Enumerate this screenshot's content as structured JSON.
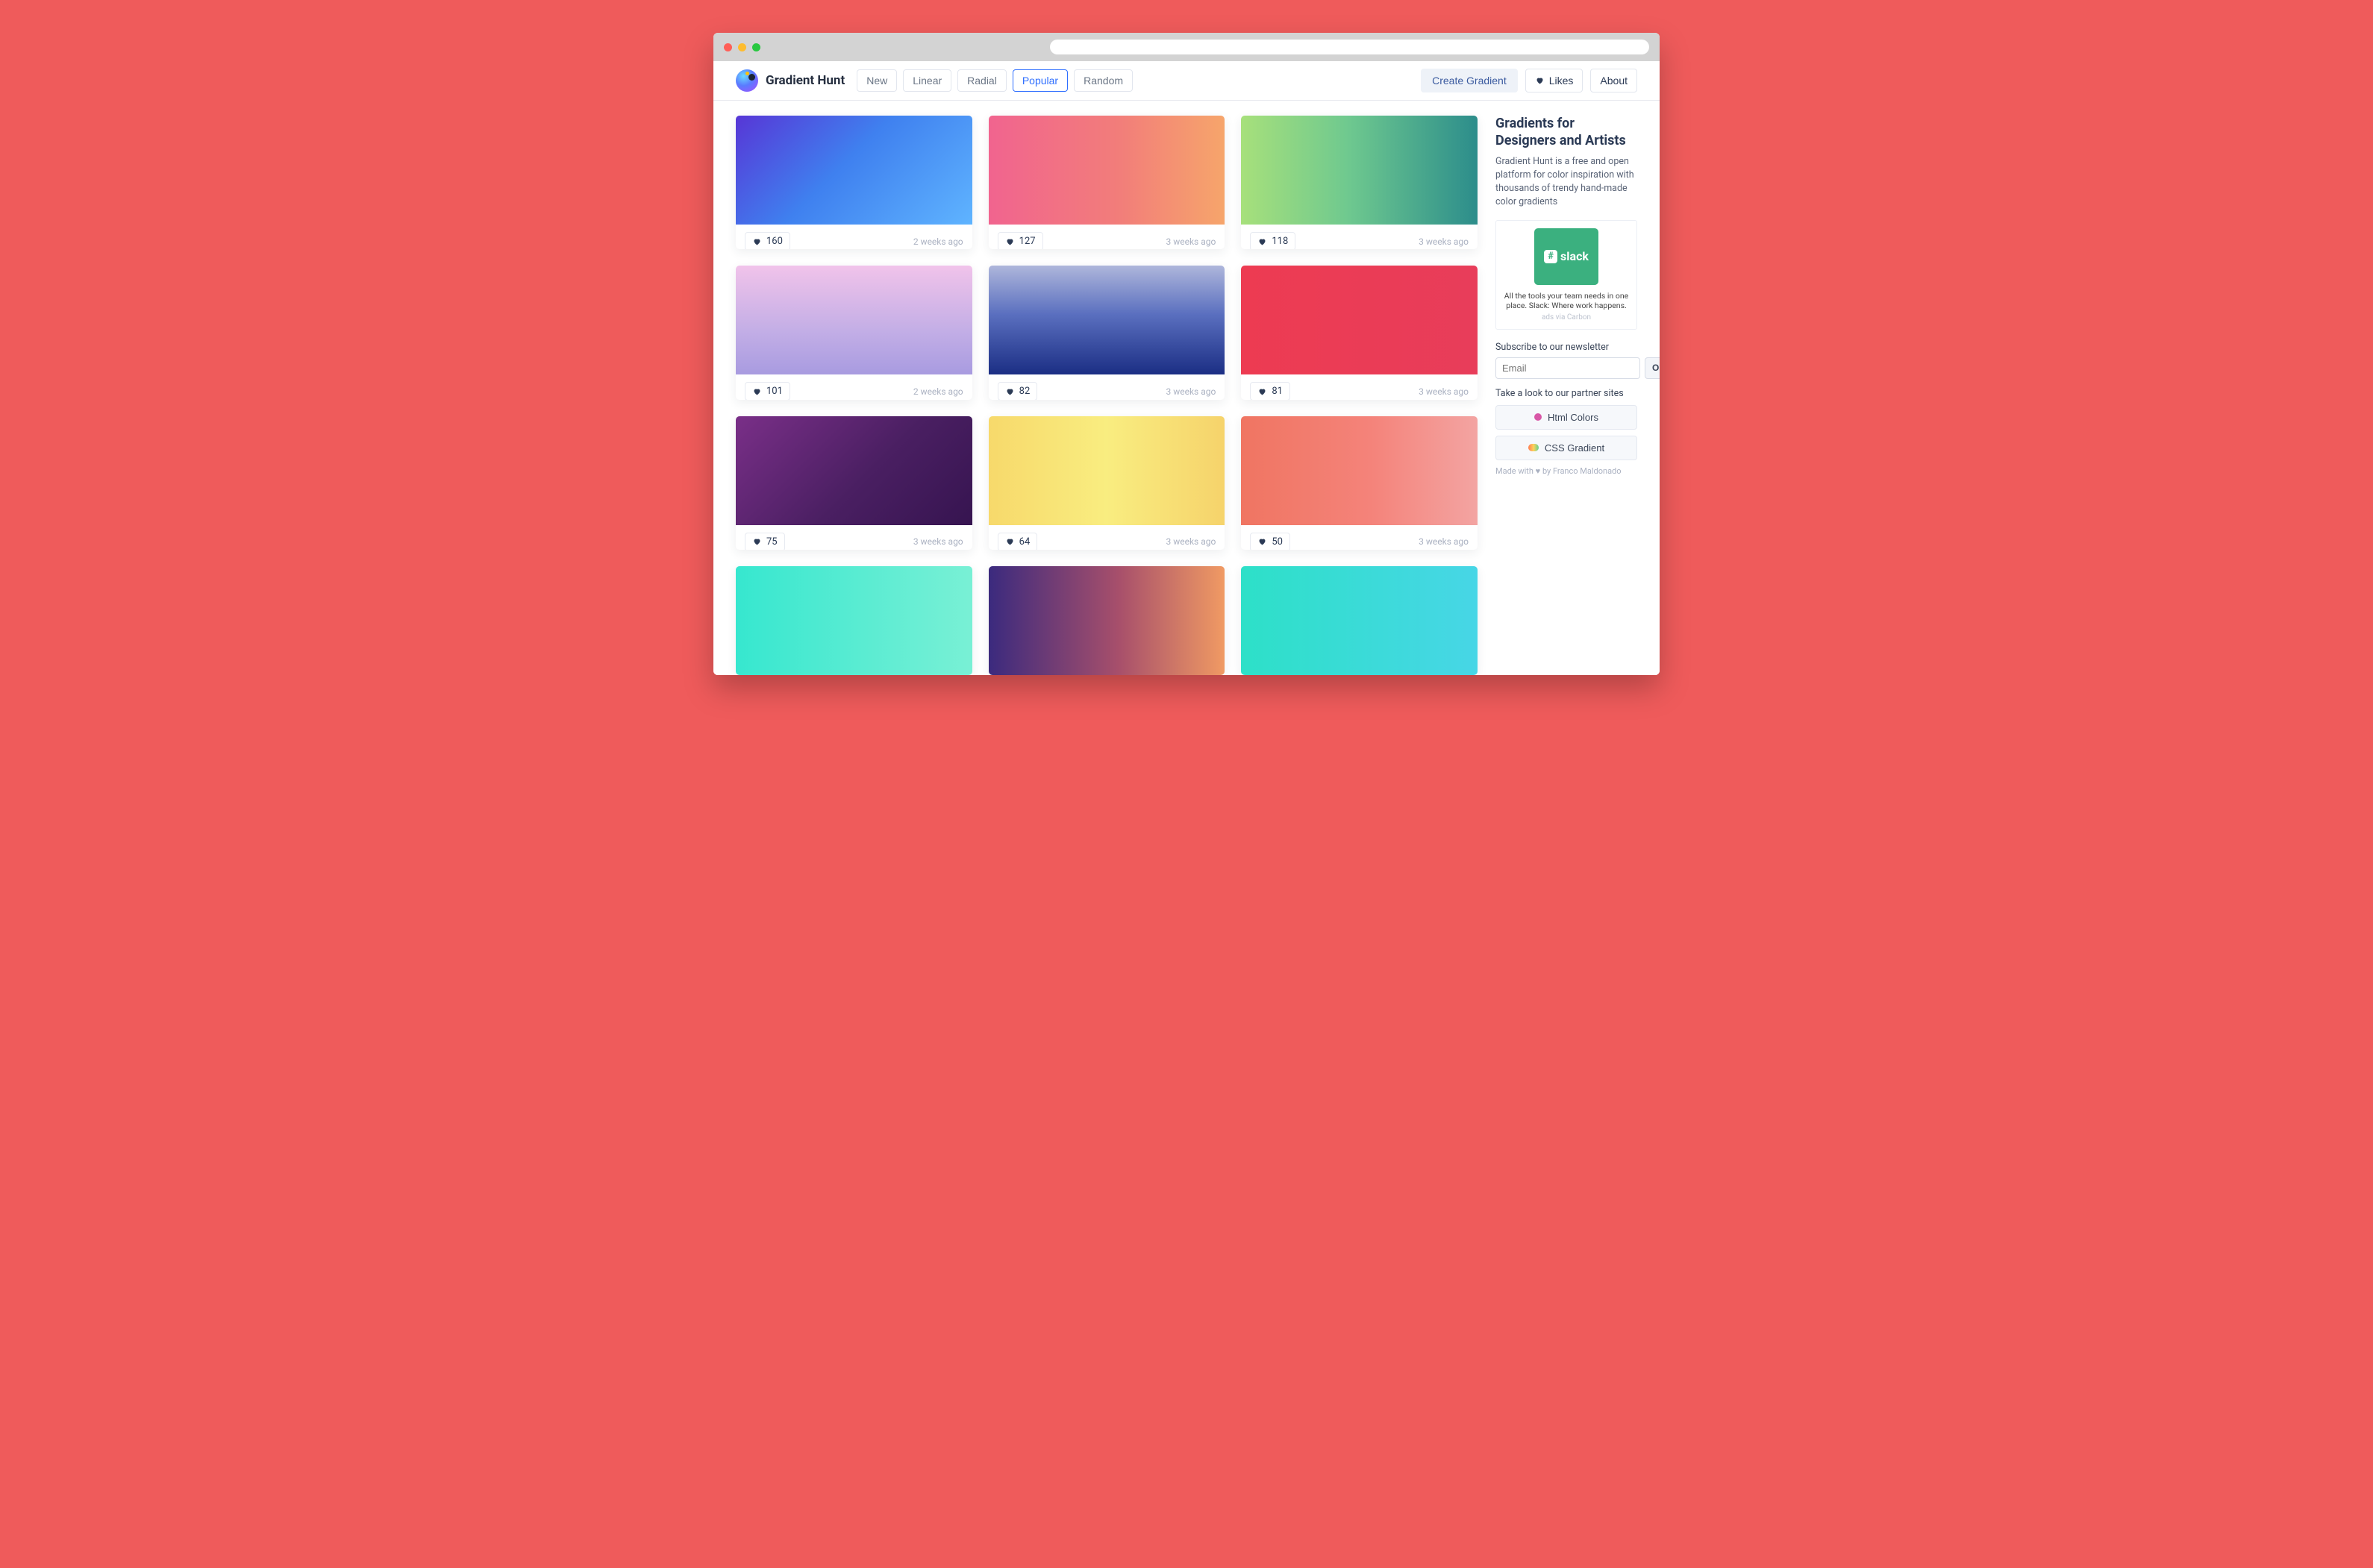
{
  "brand": "Gradient Hunt",
  "nav": {
    "items": [
      {
        "label": "New",
        "active": false
      },
      {
        "label": "Linear",
        "active": false
      },
      {
        "label": "Radial",
        "active": false
      },
      {
        "label": "Popular",
        "active": true
      },
      {
        "label": "Random",
        "active": false
      }
    ],
    "create_label": "Create Gradient",
    "likes_label": "Likes",
    "about_label": "About"
  },
  "gradients": [
    {
      "likes": "160",
      "time": "2 weeks ago",
      "css": "linear-gradient(135deg,#5736d6 0%,#3f80ef 45%,#5fb4ff 100%)"
    },
    {
      "likes": "127",
      "time": "3 weeks ago",
      "css": "linear-gradient(90deg,#f1648f 0%,#f27d7a 55%,#f6a56b 100%)"
    },
    {
      "likes": "118",
      "time": "3 weeks ago",
      "css": "linear-gradient(90deg,#a7e07b 0%,#6fc98f 45%,#2c8d8b 100%)"
    },
    {
      "likes": "101",
      "time": "2 weeks ago",
      "css": "linear-gradient(180deg,#f1c3ea 0%,#c3aee6 60%,#a89be0 100%)"
    },
    {
      "likes": "82",
      "time": "3 weeks ago",
      "css": "linear-gradient(180deg,#aeb6db 0%,#5a6fbf 45%,#1b2e84 100%)"
    },
    {
      "likes": "81",
      "time": "3 weeks ago",
      "css": "linear-gradient(90deg,#ed3b52 0%,#e83d5a 100%)"
    },
    {
      "likes": "75",
      "time": "3 weeks ago",
      "css": "linear-gradient(135deg,#7a2f88 0%,#4a1f62 55%,#361450 100%)"
    },
    {
      "likes": "64",
      "time": "3 weeks ago",
      "css": "linear-gradient(90deg,#f7d96b 0%,#f9ed80 50%,#f6d36b 100%)"
    },
    {
      "likes": "50",
      "time": "3 weeks ago",
      "css": "linear-gradient(90deg,#f07562 0%,#f4837a 55%,#f3a4a2 100%)"
    },
    {
      "likes": "",
      "time": "",
      "css": "linear-gradient(90deg,#36e7cf 0%,#79f0d5 100%)"
    },
    {
      "likes": "",
      "time": "",
      "css": "linear-gradient(90deg,#3b2a7e 0%,#a74f6b 55%,#f09a63 100%)"
    },
    {
      "likes": "",
      "time": "",
      "css": "linear-gradient(90deg,#2de0c8 0%,#47d6e6 100%)"
    }
  ],
  "sidebar": {
    "title": "Gradients for Designers and Artists",
    "desc": "Gradient Hunt is a free and open platform for color inspiration with thousands of trendy hand-made color gradients",
    "ad": {
      "logo_text": "slack",
      "text": "All the tools your team needs in one place. Slack: Where work happens.",
      "via": "ads via Carbon"
    },
    "subscribe_label": "Subscribe to our newsletter",
    "email_placeholder": "Email",
    "ok_label": "Ok",
    "partner_label": "Take a look to our partner sites",
    "partners": [
      {
        "label": "Html Colors"
      },
      {
        "label": "CSS Gradient"
      }
    ],
    "credit": "Made with ♥ by Franco Maldonado"
  }
}
